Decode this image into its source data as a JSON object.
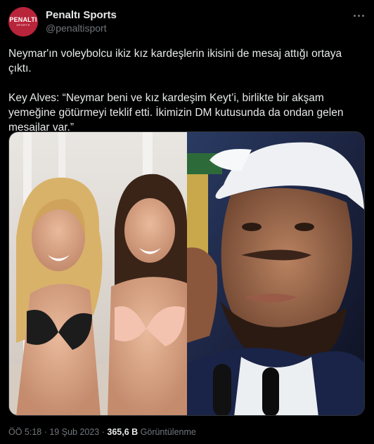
{
  "account": {
    "display_name": "Penaltı Sports",
    "handle": "@penaltisport",
    "avatar_text": "PENALTI",
    "avatar_sub": "SPORTS"
  },
  "tweet": {
    "paragraphs": [
      "Neymar'ın voleybolcu ikiz kız kardeşlerin ikisini de mesaj attığı ortaya çıktı.",
      "Key Alves: “Neymar beni ve kız kardeşim Keyt’i, birlikte bir akşam yemeğine götürmeyi teklif etti. İkimizin DM kutusunda da ondan gelen mesajlar var.”"
    ]
  },
  "meta": {
    "time": "ÖÖ 5:18",
    "date": "19 Şub 2023",
    "separator": " · ",
    "views_count": "365,6 B",
    "views_label": "Görüntülenme"
  },
  "colors": {
    "background": "#000000",
    "text": "#e7e9ea",
    "secondary": "#71767b",
    "avatar": "#b8243a"
  },
  "icons": [
    "more-icon"
  ]
}
